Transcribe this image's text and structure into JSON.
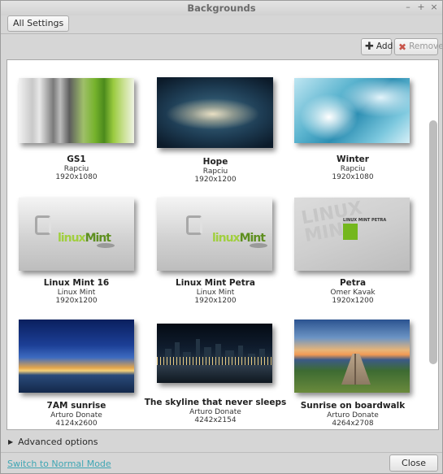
{
  "window": {
    "title": "Backgrounds",
    "controls": {
      "minimize": "–",
      "maximize": "+",
      "close": "×"
    }
  },
  "header": {
    "all_settings_label": "All Settings"
  },
  "toolbar": {
    "add_label": "Add",
    "remove_label": "Remove"
  },
  "wallpapers": [
    {
      "name": "GS1",
      "author": "Rapciu",
      "size": "1920x1080"
    },
    {
      "name": "Hope",
      "author": "Rapciu",
      "size": "1920x1200"
    },
    {
      "name": "Winter",
      "author": "Rapciu",
      "size": "1920x1080"
    },
    {
      "name": "Linux Mint 16",
      "author": "Linux Mint",
      "size": "1920x1200"
    },
    {
      "name": "Linux Mint Petra",
      "author": "Linux Mint",
      "size": "1920x1200"
    },
    {
      "name": "Petra",
      "author": "Omer Kavak",
      "size": "1920x1200"
    },
    {
      "name": "7AM sunrise",
      "author": "Arturo Donate",
      "size": "4124x2600"
    },
    {
      "name": "The skyline that never sleeps",
      "author": "Arturo Donate",
      "size": "4242x2154"
    },
    {
      "name": "Sunrise on boardwalk",
      "author": "Arturo Donate",
      "size": "4264x2708"
    }
  ],
  "thumb_text": {
    "mint_word_a": "linux",
    "mint_word_b": "Mint",
    "petra_big": "LINUX MINT",
    "petra_label": "LINUX MINT PETRA"
  },
  "advanced_options_label": "Advanced options",
  "footer": {
    "switch_label": "Switch to Normal Mode",
    "close_label": "Close"
  },
  "colors": {
    "link": "#3fa6b4",
    "remove_icon": "#c8544a",
    "mint_green": "#74b71e"
  }
}
